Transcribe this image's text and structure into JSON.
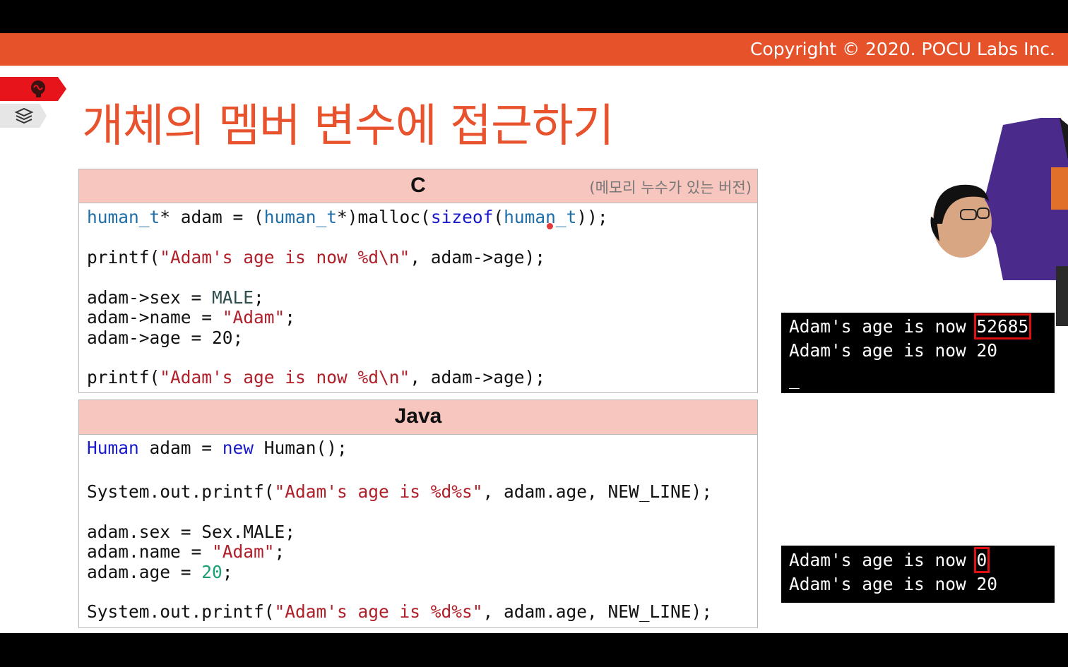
{
  "header": {
    "copyright": "Copyright © 2020. POCU Labs Inc."
  },
  "slide": {
    "title": "개체의 멤버 변수에 접근하기"
  },
  "side_tabs": [
    {
      "icon": "brain-icon"
    },
    {
      "icon": "stack-icon"
    }
  ],
  "c_panel": {
    "language": "C",
    "note": "(메모리 누수가 있는 버전)",
    "line1": {
      "t1": "human_t",
      "t2": "* adam = (",
      "t3": "human_t",
      "t4": "*)malloc(",
      "t5": "sizeof",
      "t6": "(",
      "t7": "human_t",
      "t8": "));"
    },
    "line2": {
      "t1": "printf(",
      "t2": "\"Adam's age is now %d\\n\"",
      "t3": ", adam->age);"
    },
    "line3": {
      "t1": "adam->sex = ",
      "t2": "MALE",
      "t3": ";"
    },
    "line4": {
      "t1": "adam->name = ",
      "t2": "\"Adam\"",
      "t3": ";"
    },
    "line5": {
      "t1": "adam->age = 20;"
    },
    "line6": {
      "t1": "printf(",
      "t2": "\"Adam's age is now %d\\n\"",
      "t3": ", adam->age);"
    }
  },
  "java_panel": {
    "language": "Java",
    "line1": {
      "t1": "Human",
      "t2": " adam = ",
      "t3": "new",
      "t4": " Human();"
    },
    "line2": {
      "t1": "System.out.printf(",
      "t2": "\"Adam's age is %d%s\"",
      "t3": ", adam.age, NEW_LINE);"
    },
    "line3": {
      "t1": "adam.sex = Sex.MALE;"
    },
    "line4": {
      "t1": "adam.name = ",
      "t2": "\"Adam\"",
      "t3": ";"
    },
    "line5": {
      "t1": "adam.age = ",
      "t2": "20",
      "t3": ";"
    },
    "line6": {
      "t1": "System.out.printf(",
      "t2": "\"Adam's age is %d%s\"",
      "t3": ", adam.age, NEW_LINE);"
    }
  },
  "console_c": {
    "line1_prefix": "Adam's age is now ",
    "line1_value": "52685",
    "line2": "Adam's age is now 20",
    "cursor": "_"
  },
  "console_java": {
    "line1_prefix": "Adam's age is now ",
    "line1_value": "0",
    "line2": "Adam's age is now 20"
  },
  "colors": {
    "accent": "#e6532a",
    "title": "#e8522c",
    "panel_header": "#f7c6bf",
    "highlight_box": "#e01010"
  }
}
